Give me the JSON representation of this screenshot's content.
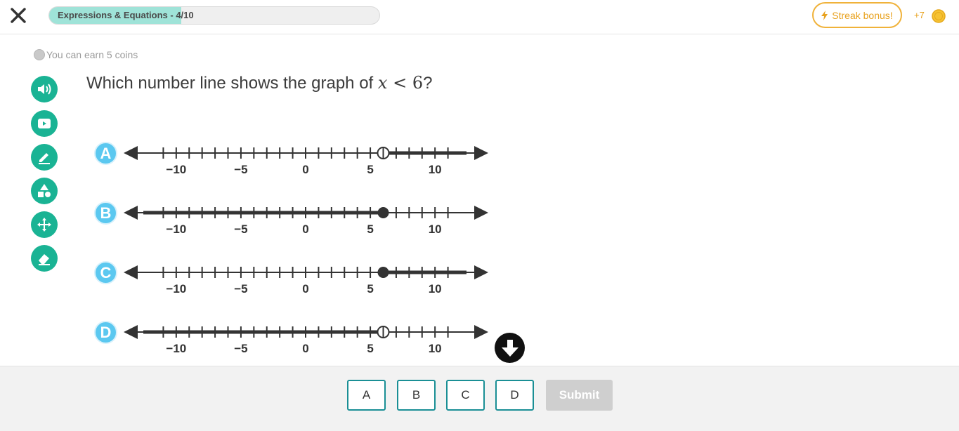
{
  "header": {
    "close_icon": "close-icon",
    "progress": {
      "label": "Expressions & Equations - 4/10",
      "fraction": 0.4
    },
    "streak_label": "Streak bonus!",
    "coins_gain": "+7",
    "colors": {
      "accent": "#1ab394",
      "progress": "#9fe3d8",
      "streak": "#f0b23a"
    }
  },
  "earn": {
    "text": "You can earn 5 coins"
  },
  "tools": [
    {
      "icon": "read-aloud-icon"
    },
    {
      "icon": "video-icon"
    },
    {
      "icon": "pencil-icon"
    },
    {
      "icon": "shapes-icon"
    },
    {
      "icon": "move-icon"
    },
    {
      "icon": "eraser-icon"
    }
  ],
  "question": {
    "prefix": "Which number line shows the graph of ",
    "var": "x",
    "op": " < ",
    "num": "6",
    "suffix": "?"
  },
  "choices": [
    {
      "letter": "A",
      "point": 6,
      "filled": false,
      "direction": "right"
    },
    {
      "letter": "B",
      "point": 6,
      "filled": true,
      "direction": "left"
    },
    {
      "letter": "C",
      "point": 6,
      "filled": true,
      "direction": "right"
    },
    {
      "letter": "D",
      "point": 6,
      "filled": false,
      "direction": "left"
    }
  ],
  "numberline": {
    "min": -12,
    "max": 12,
    "tick_step": 1,
    "labels": [
      "−10",
      "−5",
      "0",
      "5",
      "10"
    ],
    "label_values": [
      -10,
      -5,
      0,
      5,
      10
    ]
  },
  "answer_buttons": [
    "A",
    "B",
    "C",
    "D"
  ],
  "submit_label": "Submit"
}
